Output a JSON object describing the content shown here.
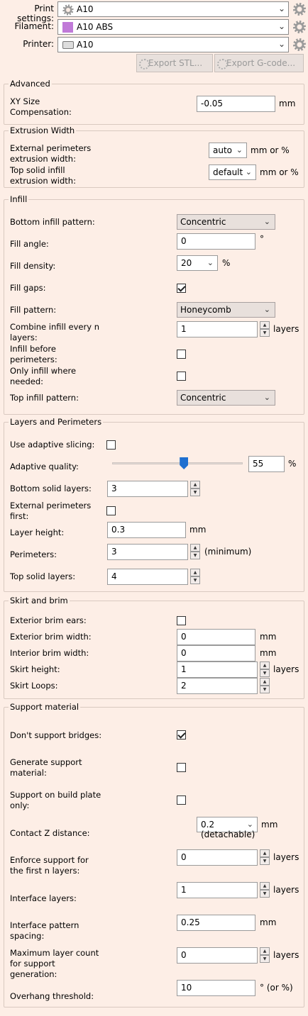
{
  "header": {
    "print_settings": {
      "label": "Print settings:",
      "value": "A10"
    },
    "filament": {
      "label": "Filament:",
      "value": "A10 ABS",
      "color": "#c07ad8"
    },
    "printer": {
      "label": "Printer:",
      "value": "A10"
    },
    "export_stl": "Export STL...",
    "export_gcode": "Export G-code..."
  },
  "advanced": {
    "title": "Advanced",
    "xy_label_1": "XY Size",
    "xy_label_2": "Compensation:",
    "xy_value": "-0.05",
    "xy_unit": "mm"
  },
  "extrusion": {
    "title": "Extrusion Width",
    "ext_label_1": "External perimeters",
    "ext_label_2": "extrusion width:",
    "ext_value": "auto",
    "ext_unit": "mm or %",
    "top_label_1": "Top solid infill",
    "top_label_2": "extrusion width:",
    "top_value": "default",
    "top_unit": "mm or %"
  },
  "infill": {
    "title": "Infill",
    "bottom_pattern_label": "Bottom infill pattern:",
    "bottom_pattern_value": "Concentric",
    "fill_angle_label": "Fill angle:",
    "fill_angle_value": "0",
    "fill_angle_unit": "°",
    "fill_density_label": "Fill density:",
    "fill_density_value": "20",
    "fill_density_unit": "%",
    "fill_gaps_label": "Fill gaps:",
    "fill_gaps_checked": true,
    "fill_pattern_label": "Fill pattern:",
    "fill_pattern_value": "Honeycomb",
    "combine_label_1": "Combine infill every n",
    "combine_label_2": "layers:",
    "combine_value": "1",
    "combine_unit": "layers",
    "before_label_1": "Infill before",
    "before_label_2": "perimeters:",
    "before_checked": false,
    "only_label_1": "Only infill where",
    "only_label_2": "needed:",
    "only_checked": false,
    "top_pattern_label": "Top infill pattern:",
    "top_pattern_value": "Concentric"
  },
  "layers": {
    "title": "Layers and Perimeters",
    "adaptive_slicing_label": "Use adaptive slicing:",
    "adaptive_slicing_checked": false,
    "adaptive_quality_label": "Adaptive quality:",
    "adaptive_quality_value": "55",
    "adaptive_quality_unit": "%",
    "adaptive_quality_slider_fraction": 0.55,
    "bottom_solid_label": "Bottom solid layers:",
    "bottom_solid_value": "3",
    "ext_first_label_1": "External perimeters",
    "ext_first_label_2": "first:",
    "ext_first_checked": false,
    "layer_height_label": "Layer height:",
    "layer_height_value": "0.3",
    "layer_height_unit": "mm",
    "perimeters_label": "Perimeters:",
    "perimeters_value": "3",
    "perimeters_unit": "(minimum)",
    "top_solid_label": "Top solid layers:",
    "top_solid_value": "4"
  },
  "skirt": {
    "title": "Skirt and brim",
    "ears_label": "Exterior brim ears:",
    "ears_checked": false,
    "ext_brim_label": "Exterior brim width:",
    "ext_brim_value": "0",
    "ext_brim_unit": "mm",
    "int_brim_label": "Interior brim width:",
    "int_brim_value": "0",
    "int_brim_unit": "mm",
    "skirt_height_label": "Skirt height:",
    "skirt_height_value": "1",
    "skirt_height_unit": "layers",
    "skirt_loops_label": "Skirt Loops:",
    "skirt_loops_value": "2"
  },
  "support": {
    "title": "Support material",
    "bridges_label": "Don't support bridges:",
    "bridges_checked": true,
    "generate_label_1": "Generate support",
    "generate_label_2": "material:",
    "generate_checked": false,
    "buildplate_label_1": "Support on build plate",
    "buildplate_label_2": "only:",
    "buildplate_checked": false,
    "contact_z_label": "Contact Z distance:",
    "contact_z_value": "0.2 (detachable)",
    "contact_z_unit": "mm",
    "enforce_label_1": "Enforce support for",
    "enforce_label_2": "the first n layers:",
    "enforce_value": "0",
    "enforce_unit": "layers",
    "interface_layers_label": "Interface layers:",
    "interface_layers_value": "1",
    "interface_layers_unit": "layers",
    "pattern_spacing_label_1": "Interface pattern",
    "pattern_spacing_label_2": "spacing:",
    "pattern_spacing_value": "0.25",
    "pattern_spacing_unit": "mm",
    "max_layer_label_1": "Maximum layer count",
    "max_layer_label_2": "for support",
    "max_layer_label_3": "generation:",
    "max_layer_value": "0",
    "max_layer_unit": "layers",
    "overhang_label": "Overhang threshold:",
    "overhang_value": "10",
    "overhang_unit": "° (or %)"
  }
}
